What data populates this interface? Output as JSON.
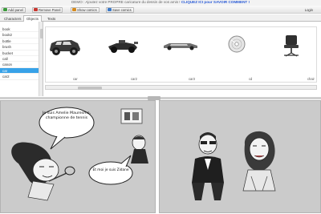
{
  "notice": {
    "text": "DEMO : Ajoutez votre PROPRE caricature du dessin de vos amis !",
    "link": "CLIQUEZ ICI pour SAVOIR COMMENT !"
  },
  "toolbar": {
    "add_panel": "Add panel",
    "remove_panel": "Remove Panel",
    "show_comics": "Show comics",
    "save_comics": "Save comics",
    "login": "Login",
    "colors": {
      "add": "#3c9a3c",
      "remove": "#c8362f",
      "show": "#d68a1c",
      "save": "#3a78c8"
    }
  },
  "tabs": [
    "Characters",
    "Objects",
    "Texts"
  ],
  "active_tab": "Objects",
  "sidebar": {
    "items": [
      "book",
      "book2",
      "bottle",
      "brush",
      "bucket",
      "call",
      "canon",
      "car",
      "car2"
    ],
    "selected": "car"
  },
  "gallery": {
    "items": [
      {
        "label": "car",
        "icon": "car-icon"
      },
      {
        "label": "car2",
        "icon": "car2-icon"
      },
      {
        "label": "car3",
        "icon": "car3-icon"
      },
      {
        "label": "cd",
        "icon": "cd-icon"
      },
      {
        "label": "chair",
        "icon": "chair-icon"
      }
    ]
  },
  "panels": {
    "panel1": {
      "bubble1": "Je suis Amelie Mauresmo, championne de tennis",
      "bubble2": "Et moi je suis Zidane"
    }
  },
  "accent": "#38a2e8"
}
